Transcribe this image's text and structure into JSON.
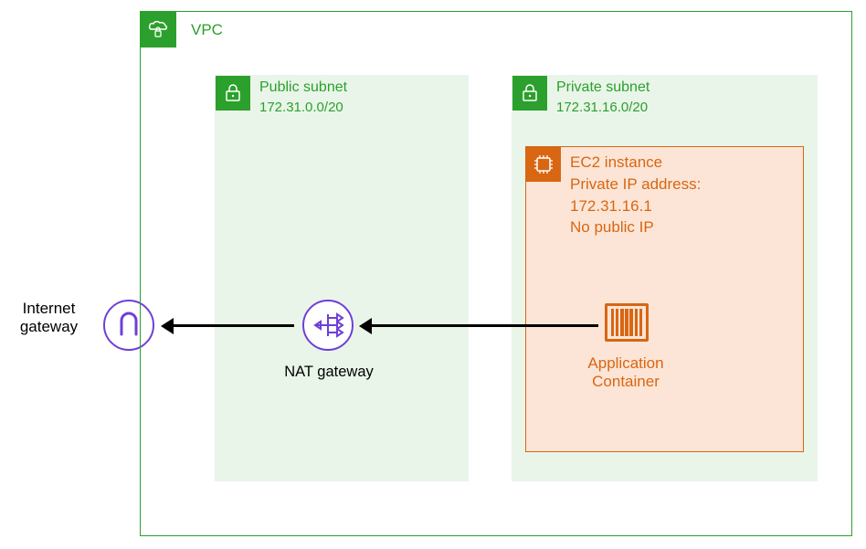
{
  "vpc": {
    "label": "VPC"
  },
  "public_subnet": {
    "label": "Public subnet",
    "cidr": "172.31.0.0/20"
  },
  "private_subnet": {
    "label": "Private subnet",
    "cidr": "172.31.16.0/20"
  },
  "ec2": {
    "title": "EC2 instance",
    "private_ip_label": "Private IP address:",
    "private_ip": "172.31.16.1",
    "public_ip_note": "No public IP"
  },
  "container": {
    "label_line1": "Application",
    "label_line2": "Container"
  },
  "nat": {
    "label": "NAT gateway"
  },
  "igw": {
    "label_line1": "Internet",
    "label_line2": "gateway"
  }
}
